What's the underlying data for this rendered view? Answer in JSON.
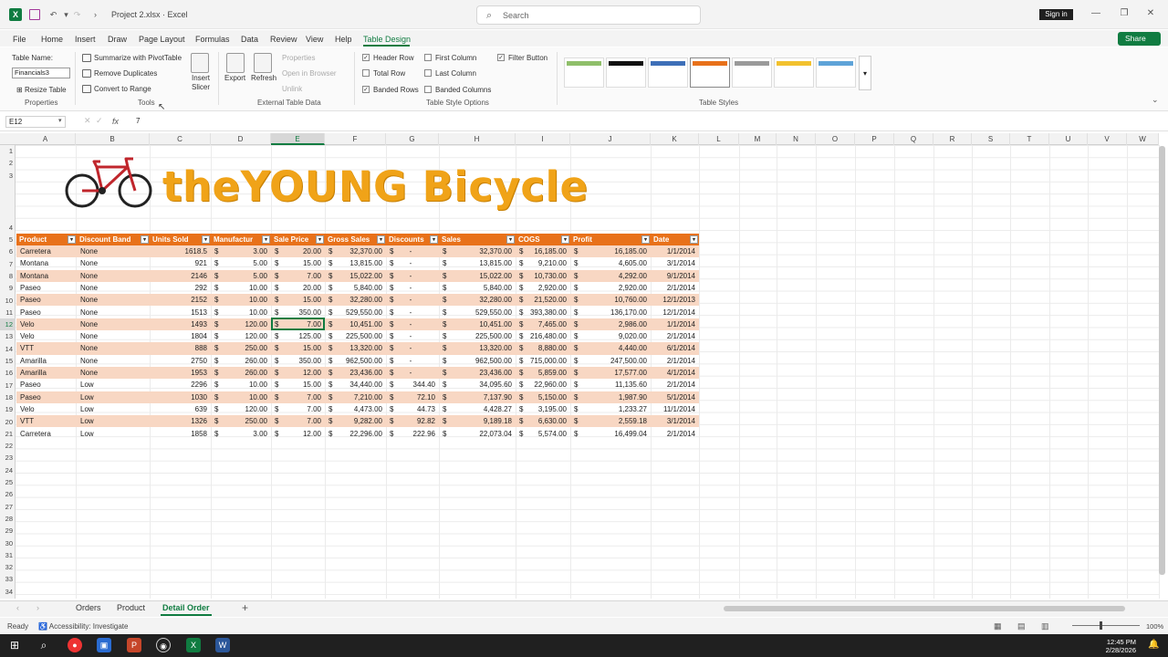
{
  "window": {
    "title": "Project 2.xlsx  ·  Excel",
    "search_placeholder": "Search",
    "sign_in": "Sign in",
    "share": "Share"
  },
  "menu": [
    "File",
    "Home",
    "Insert",
    "Draw",
    "Page Layout",
    "Formulas",
    "Data",
    "Review",
    "View",
    "Help",
    "Table Design"
  ],
  "ribbon": {
    "table_name_label": "Table Name:",
    "table_name_value": "Financials3",
    "resize_table": "Resize Table",
    "properties_group": "Properties",
    "summarize": "Summarize with PivotTable",
    "remove_duplicates": "Remove Duplicates",
    "convert_to_range": "Convert to Range",
    "tools_group": "Tools",
    "insert_slicer": "Insert Slicer",
    "export": "Export",
    "refresh": "Refresh",
    "properties": "Properties",
    "open_in_browser": "Open in Browser",
    "unlink": "Unlink",
    "external_group": "External Table Data",
    "header_row": "Header Row",
    "total_row": "Total Row",
    "banded_rows": "Banded Rows",
    "first_column": "First Column",
    "last_column": "Last Column",
    "banded_columns": "Banded Columns",
    "filter_button": "Filter Button",
    "style_options_group": "Table Style Options",
    "table_styles_group": "Table Styles"
  },
  "formula_bar": {
    "name_box": "E12",
    "fx": "fx",
    "value": "7"
  },
  "columns": [
    "A",
    "B",
    "C",
    "D",
    "E",
    "F",
    "G",
    "H",
    "I",
    "J",
    "K",
    "L",
    "M",
    "N",
    "O",
    "P",
    "Q",
    "R",
    "S",
    "T",
    "U",
    "V",
    "W"
  ],
  "rows": [
    "1",
    "2",
    "3",
    "4",
    "5",
    "6",
    "7",
    "8",
    "9",
    "10",
    "11",
    "12",
    "13",
    "14",
    "15",
    "16",
    "17",
    "18",
    "19",
    "20",
    "21",
    "22",
    "23",
    "24",
    "25",
    "26",
    "27",
    "28",
    "29",
    "30",
    "31",
    "32",
    "33",
    "34"
  ],
  "banner": "theYOUNG Bicycle",
  "table": {
    "headers": [
      "Product",
      "Discount Band",
      "Units Sold",
      "Manufactur",
      "Sale Price",
      "Gross Sales",
      "Discounts",
      "Sales",
      "COGS",
      "Profit",
      "Date"
    ],
    "rows": [
      [
        "Carretera",
        "None",
        "1618.5",
        "3.00",
        "20.00",
        "32,370.00",
        "-",
        "32,370.00",
        "16,185.00",
        "16,185.00",
        "1/1/2014"
      ],
      [
        "Montana",
        "None",
        "921",
        "5.00",
        "15.00",
        "13,815.00",
        "-",
        "13,815.00",
        "9,210.00",
        "4,605.00",
        "3/1/2014"
      ],
      [
        "Montana",
        "None",
        "2146",
        "5.00",
        "7.00",
        "15,022.00",
        "-",
        "15,022.00",
        "10,730.00",
        "4,292.00",
        "9/1/2014"
      ],
      [
        "Paseo",
        "None",
        "292",
        "10.00",
        "20.00",
        "5,840.00",
        "-",
        "5,840.00",
        "2,920.00",
        "2,920.00",
        "2/1/2014"
      ],
      [
        "Paseo",
        "None",
        "2152",
        "10.00",
        "15.00",
        "32,280.00",
        "-",
        "32,280.00",
        "21,520.00",
        "10,760.00",
        "12/1/2013"
      ],
      [
        "Paseo",
        "None",
        "1513",
        "10.00",
        "350.00",
        "529,550.00",
        "-",
        "529,550.00",
        "393,380.00",
        "136,170.00",
        "12/1/2014"
      ],
      [
        "Velo",
        "None",
        "1493",
        "120.00",
        "7.00",
        "10,451.00",
        "-",
        "10,451.00",
        "7,465.00",
        "2,986.00",
        "1/1/2014"
      ],
      [
        "Velo",
        "None",
        "1804",
        "120.00",
        "125.00",
        "225,500.00",
        "-",
        "225,500.00",
        "216,480.00",
        "9,020.00",
        "2/1/2014"
      ],
      [
        "VTT",
        "None",
        "888",
        "250.00",
        "15.00",
        "13,320.00",
        "-",
        "13,320.00",
        "8,880.00",
        "4,440.00",
        "6/1/2014"
      ],
      [
        "Amarilla",
        "None",
        "2750",
        "260.00",
        "350.00",
        "962,500.00",
        "-",
        "962,500.00",
        "715,000.00",
        "247,500.00",
        "2/1/2014"
      ],
      [
        "Amarilla",
        "None",
        "1953",
        "260.00",
        "12.00",
        "23,436.00",
        "-",
        "23,436.00",
        "5,859.00",
        "17,577.00",
        "4/1/2014"
      ],
      [
        "Paseo",
        "Low",
        "2296",
        "10.00",
        "15.00",
        "34,440.00",
        "344.40",
        "34,095.60",
        "22,960.00",
        "11,135.60",
        "2/1/2014"
      ],
      [
        "Paseo",
        "Low",
        "1030",
        "10.00",
        "7.00",
        "7,210.00",
        "72.10",
        "7,137.90",
        "5,150.00",
        "1,987.90",
        "5/1/2014"
      ],
      [
        "Velo",
        "Low",
        "639",
        "120.00",
        "7.00",
        "4,473.00",
        "44.73",
        "4,428.27",
        "3,195.00",
        "1,233.27",
        "11/1/2014"
      ],
      [
        "VTT",
        "Low",
        "1326",
        "250.00",
        "7.00",
        "9,282.00",
        "92.82",
        "9,189.18",
        "6,630.00",
        "2,559.18",
        "3/1/2014"
      ],
      [
        "Carretera",
        "Low",
        "1858",
        "3.00",
        "12.00",
        "22,296.00",
        "222.96",
        "22,073.04",
        "5,574.00",
        "16,499.04",
        "2/1/2014"
      ]
    ]
  },
  "sheets": [
    "Orders",
    "Product",
    "Detail Order"
  ],
  "active_sheet": "Detail Order",
  "status": {
    "ready": "Ready",
    "accessibility": "Accessibility: Investigate",
    "zoom": "100%"
  },
  "taskbar": {
    "time": "12:45 PM",
    "date": "2/28/2026"
  },
  "colors": {
    "excel_green": "#107c41",
    "table_header": "#e8711a",
    "band": "#f8d7c3",
    "banner": "#f0a318"
  }
}
